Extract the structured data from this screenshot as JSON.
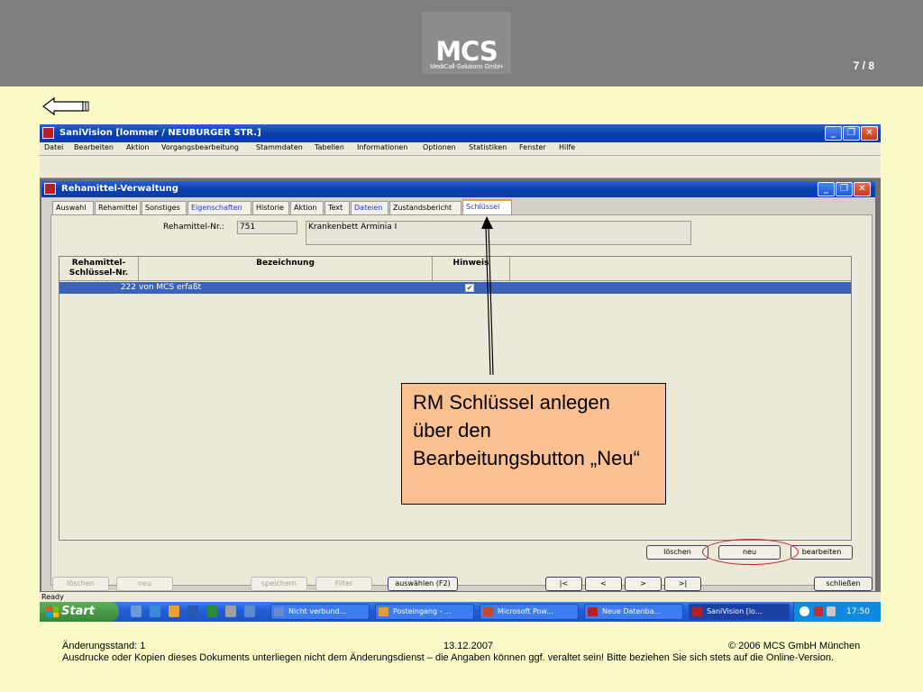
{
  "slide": {
    "logo_main": "MCS",
    "logo_sub": "MediCall-Solutions GmbH",
    "page_number": "7 / 8"
  },
  "app": {
    "title": "SaniVision  [lommer / NEUBURGER STR.]",
    "menu": [
      "Datei",
      "Bearbeiten",
      "Aktion",
      "Vorgangsbearbeitung",
      "Stammdaten",
      "Tabellen",
      "Informationen",
      "Optionen",
      "Statistiken",
      "Fenster",
      "Hilfe"
    ],
    "status_text": "Ready"
  },
  "child_window": {
    "title": "Rehamittel-Verwaltung",
    "tabs": [
      {
        "label": "Auswahl",
        "style": "normal"
      },
      {
        "label": "Rehamittel",
        "style": "normal"
      },
      {
        "label": "Sonstiges",
        "style": "normal"
      },
      {
        "label": "Eigenschaften",
        "style": "blue"
      },
      {
        "label": "Historie",
        "style": "normal"
      },
      {
        "label": "Aktion",
        "style": "normal"
      },
      {
        "label": "Text",
        "style": "normal"
      },
      {
        "label": "Dateien",
        "style": "blue"
      },
      {
        "label": "Zustandsbericht",
        "style": "normal"
      },
      {
        "label": "Schlüssel",
        "style": "active"
      }
    ],
    "rehamittel_nr_label": "Rehamittel-Nr.:",
    "rehamittel_nr_value": "751",
    "rehamittel_name": "Krankenbett Arminia I",
    "grid": {
      "headers": [
        "Rehamittel-\nSchlüssel-Nr.",
        "Bezeichnung",
        "Hinweis"
      ],
      "rows": [
        {
          "nr": "222",
          "bezeichnung": "von MCS erfaßt",
          "hinweis": true
        }
      ]
    },
    "buttons": {
      "loeschen": "löschen",
      "neu": "neu",
      "bearbeiten": "bearbeiten"
    },
    "bottom_buttons": {
      "loeschen": "löschen",
      "neu": "neu",
      "speichern": "speichern",
      "filter": "Filter",
      "auswaehlen": "auswählen (F2)",
      "first": "|<",
      "prev": "<",
      "next": ">",
      "last": ">|",
      "schliessen": "schließen"
    }
  },
  "taskbar": {
    "start_label": "Start",
    "tasks": [
      {
        "label": "Nicht verbund...",
        "icon_color": "#6a8ad0",
        "active": false
      },
      {
        "label": "Posteingang - ...",
        "icon_color": "#e0a030",
        "active": false
      },
      {
        "label": "Microsoft Pow...",
        "icon_color": "#c24a2a",
        "active": false
      },
      {
        "label": "Neue Datenba...",
        "icon_color": "#b62020",
        "active": false
      },
      {
        "label": "SaniVision  [lo...",
        "icon_color": "#b62020",
        "active": true
      }
    ],
    "clock": "17:50"
  },
  "callout": {
    "text": "RM Schlüssel anlegen über den Bearbeitungsbutton „Neu“"
  },
  "footer": {
    "change_status": "Änderungsstand: 1",
    "date": "13.12.2007",
    "copyright": "© 2006 MCS GmbH München",
    "disclaimer": "Ausdrucke oder Kopien dieses Dokuments unterliegen nicht dem Änderungsdienst – die Angaben können ggf. veraltet sein! Bitte beziehen Sie sich stets auf die Online-Version."
  },
  "colors": {
    "slide_background": "#fafac7",
    "header_gray": "#7f7f7f",
    "callout_fill": "#fac090",
    "xp_blue": "#0a3ea8",
    "selection_blue": "#3b63b8",
    "highlight_red": "#c02020"
  }
}
